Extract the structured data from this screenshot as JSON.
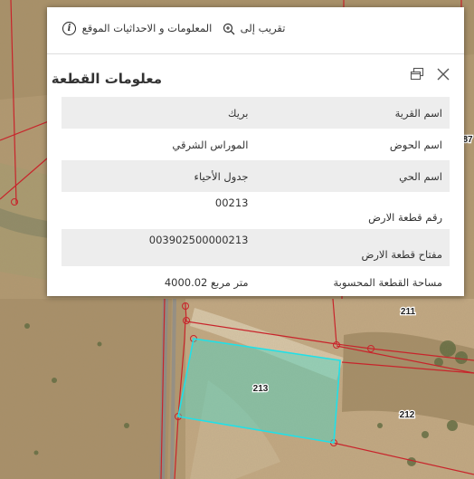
{
  "map": {
    "parcel_labels": {
      "p211": "211",
      "p212": "212",
      "p213": "213",
      "p87": "87"
    },
    "colors": {
      "boundary": "#c8242b",
      "selection_stroke": "#20e0e8",
      "selection_fill": "#49d6c6"
    }
  },
  "popup": {
    "actions": {
      "location_info": "المعلومات و الاحداثيات الموقع",
      "zoom_to": "تقريب إلى"
    },
    "title": "معلومات القطعة",
    "attributes": [
      {
        "key": "اسم القرية",
        "value": "بريك"
      },
      {
        "key": "اسم الحوض",
        "value": "الموراس الشرقي"
      },
      {
        "key": "اسم الحي",
        "value": "جدول الأحياء"
      },
      {
        "key": "رقم قطعة الارض",
        "value": "00213"
      },
      {
        "key": "مفتاح قطعة الارض",
        "value": "003902500000213"
      },
      {
        "key": "مساحة القطعة المحسوبة",
        "value": "4000.02 متر مربع"
      }
    ],
    "icons": {
      "info": "info-icon",
      "zoom": "zoom-in-icon",
      "restore": "restore-window-icon",
      "close": "close-icon"
    }
  }
}
